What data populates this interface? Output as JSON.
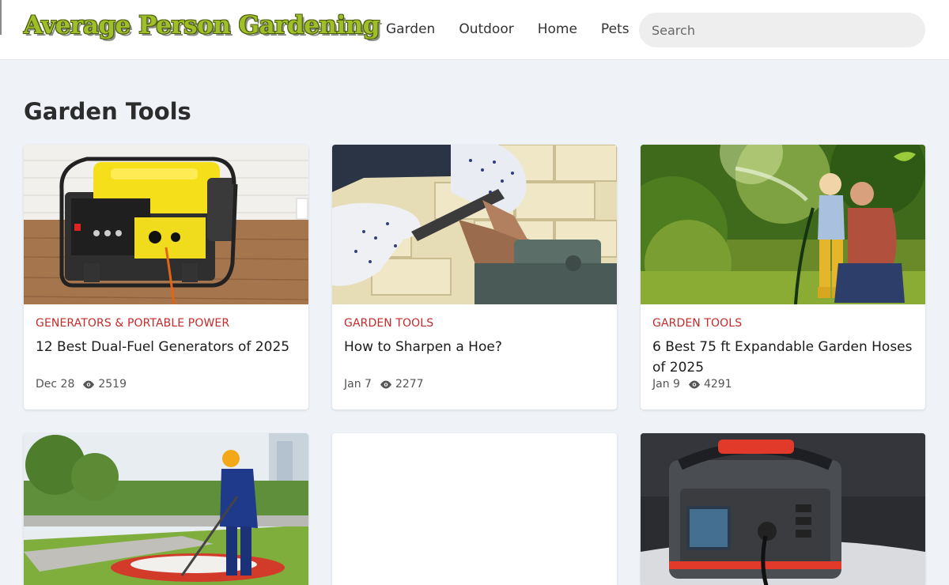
{
  "site": {
    "logo_text": "Average Person Gardening"
  },
  "nav": {
    "items": [
      "Garden",
      "Outdoor",
      "Home",
      "Pets"
    ]
  },
  "search": {
    "placeholder": "Search"
  },
  "page": {
    "title": "Garden Tools"
  },
  "cards": [
    {
      "category": "Generators & Portable Power",
      "title": "12 Best Dual-Fuel Generators of 2025",
      "date": "Dec 28",
      "views": "2519"
    },
    {
      "category": "Garden Tools",
      "title": "How to Sharpen a Hoe?",
      "date": "Jan 7",
      "views": "2277"
    },
    {
      "category": "Garden Tools",
      "title": "6 Best 75 ft Expandable Garden Hoses of 2025",
      "date": "Jan 9",
      "views": "4291"
    }
  ],
  "colors": {
    "accent_category": "#c62a2a",
    "logo_green": "#9ebf27",
    "page_background": "#eff3f7"
  }
}
